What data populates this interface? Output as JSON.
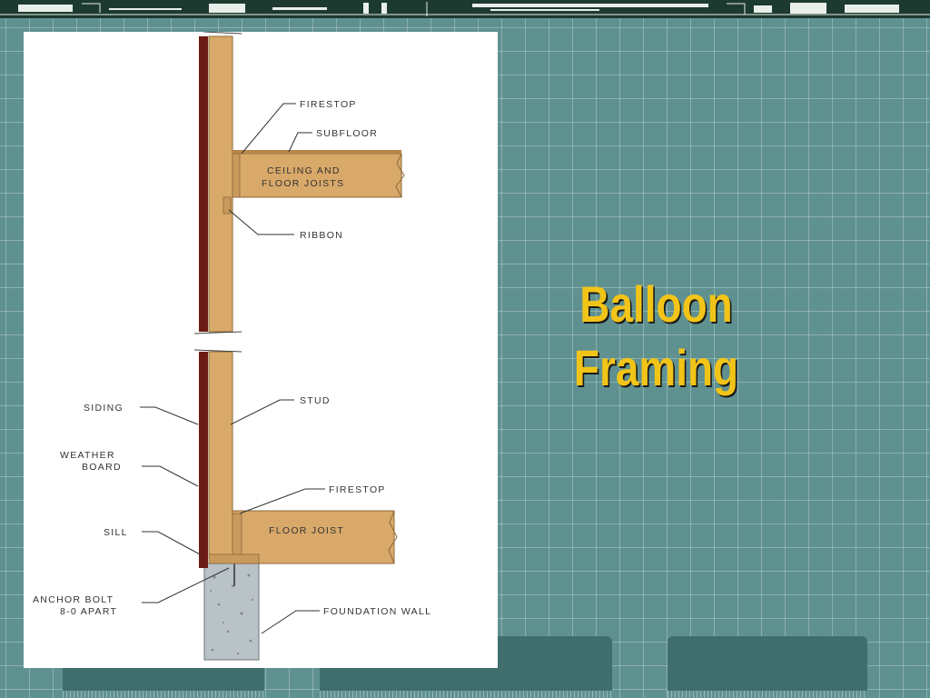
{
  "slide": {
    "title_line1": "Balloon",
    "title_line2": "Framing"
  },
  "diagram": {
    "labels": {
      "firestop_top": "FIRESTOP",
      "subfloor": "SUBFLOOR",
      "joist_upper_line1": "CEILING AND",
      "joist_upper_line2": "FLOOR JOISTS",
      "ribbon": "RIBBON",
      "siding": "SIDING",
      "stud": "STUD",
      "weather_board_line1": "WEATHER",
      "weather_board_line2": "BOARD",
      "firestop_bottom": "FIRESTOP",
      "floor_joist": "FLOOR JOIST",
      "sill": "SILL",
      "anchor_bolt_line1": "ANCHOR BOLT",
      "anchor_bolt_line2": "8-0 APART",
      "foundation_wall": "FOUNDATION WALL"
    }
  },
  "colors": {
    "background": "#5f9190",
    "title": "#f2c418",
    "wood": "#d9a96a",
    "siding": "#6b1a14"
  }
}
